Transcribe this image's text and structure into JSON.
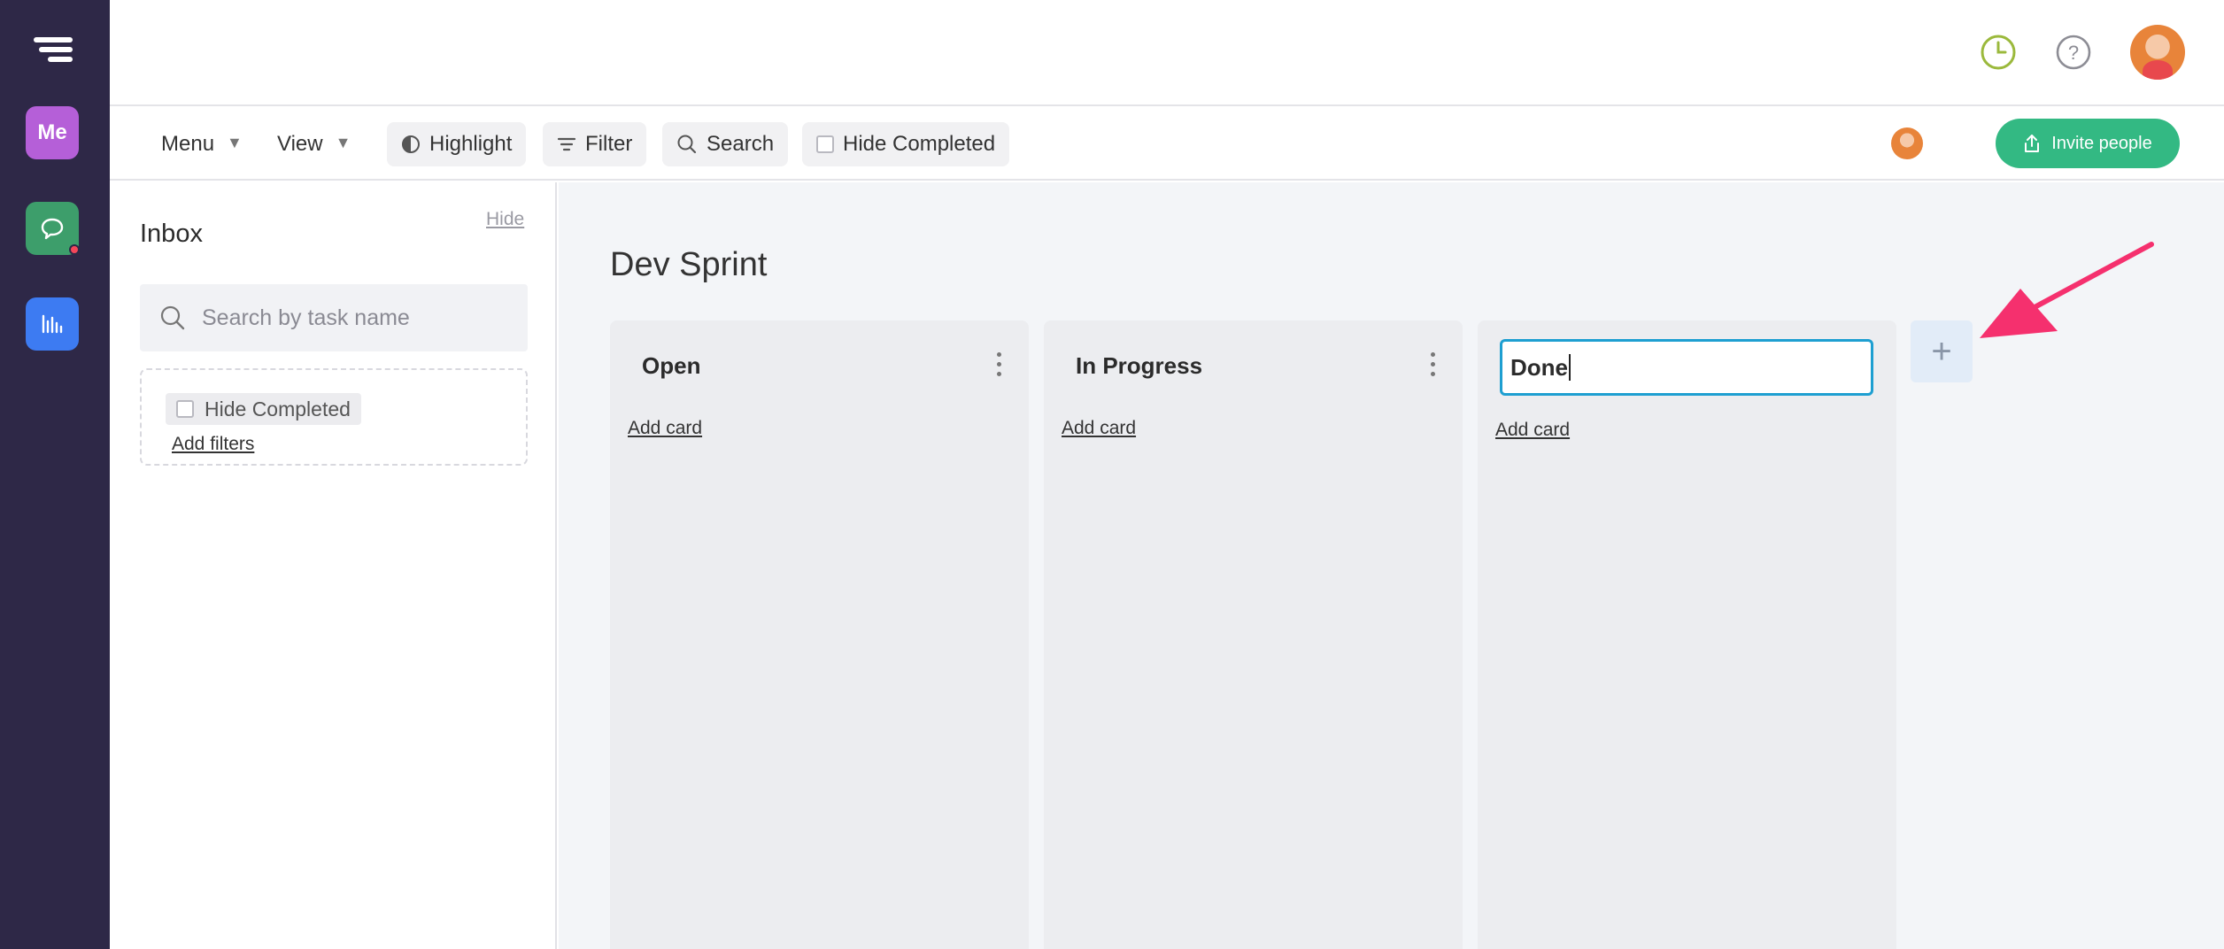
{
  "topbar": {
    "icons": [
      "clock-icon",
      "help-icon"
    ],
    "avatar": "user-avatar"
  },
  "sidebar": {
    "me_label": "Me",
    "items": [
      "logo-icon",
      "chat-icon",
      "chart-icon"
    ]
  },
  "toolbar": {
    "menu_label": "Menu",
    "view_label": "View",
    "highlight_label": "Highlight",
    "filter_label": "Filter",
    "search_label": "Search",
    "hide_completed_label": "Hide Completed",
    "invite_label": "Invite people"
  },
  "inbox": {
    "title": "Inbox",
    "hide_label": "Hide",
    "search_placeholder": "Search by task name",
    "hide_completed_label": "Hide Completed",
    "add_filters_label": "Add filters"
  },
  "board": {
    "title": "Dev Sprint",
    "columns": [
      {
        "name": "Open",
        "add_card": "Add card"
      },
      {
        "name": "In Progress",
        "add_card": "Add card"
      },
      {
        "name": "Done",
        "add_card": "Add card",
        "editing": true
      }
    ],
    "add_column_symbol": "+"
  },
  "colors": {
    "rail": "#2e2847",
    "me": "#b55fd8",
    "chat": "#3d9e6b",
    "chart": "#3d7bf2",
    "invite": "#33b983",
    "input_border": "#1e9fd1",
    "arrow": "#f5306e"
  }
}
